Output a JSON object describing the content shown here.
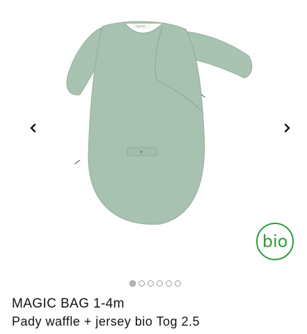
{
  "product": {
    "name": "MAGIC BAG",
    "size": "1-4m",
    "description": "Pady waffle + jersey bio Tog 2.5",
    "image_label": "bemini"
  },
  "badge": {
    "label": "bio",
    "color": "#2e9b3a"
  },
  "carousel": {
    "prev_icon": "chevron-left-icon",
    "next_icon": "chevron-right-icon",
    "dot_count": 6,
    "active_index": 0
  },
  "colors": {
    "fabric": "#a8c2b1",
    "fabric_shadow": "#8fab99"
  }
}
